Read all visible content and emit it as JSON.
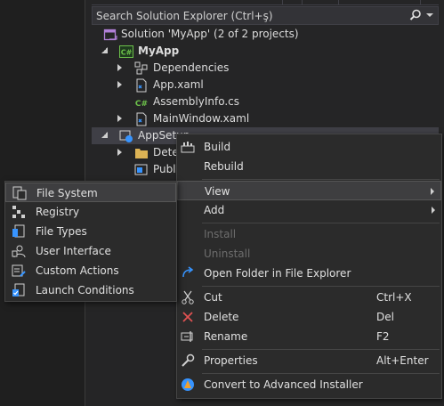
{
  "search": {
    "placeholder": "Search Solution Explorer (Ctrl+ş)",
    "icon": "search-icon"
  },
  "tree": {
    "solution": "Solution 'MyApp' (2 of 2 projects)",
    "project": "MyApp",
    "dependencies": "Dependencies",
    "app_xaml": "App.xaml",
    "assembly_info": "AssemblyInfo.cs",
    "main_window": "MainWindow.xaml",
    "setup_project": "AppSetup",
    "detected": "Dete",
    "publish": "Publ"
  },
  "context_menu": {
    "build": "Build",
    "rebuild": "Rebuild",
    "view": "View",
    "add": "Add",
    "install": "Install",
    "uninstall": "Uninstall",
    "open_folder": "Open Folder in File Explorer",
    "cut": "Cut",
    "cut_key": "Ctrl+X",
    "delete": "Delete",
    "delete_key": "Del",
    "rename": "Rename",
    "rename_key": "F2",
    "properties": "Properties",
    "properties_key": "Alt+Enter",
    "convert": "Convert to Advanced Installer"
  },
  "view_submenu": {
    "file_system": "File System",
    "registry": "Registry",
    "file_types": "File Types",
    "user_interface": "User Interface",
    "custom_actions": "Custom Actions",
    "launch_conditions": "Launch Conditions"
  },
  "colors": {
    "accent_blue": "#3794ff",
    "csharp_green": "#6cc04a",
    "delete_red": "#e05252",
    "folder_yellow": "#dcb355"
  }
}
